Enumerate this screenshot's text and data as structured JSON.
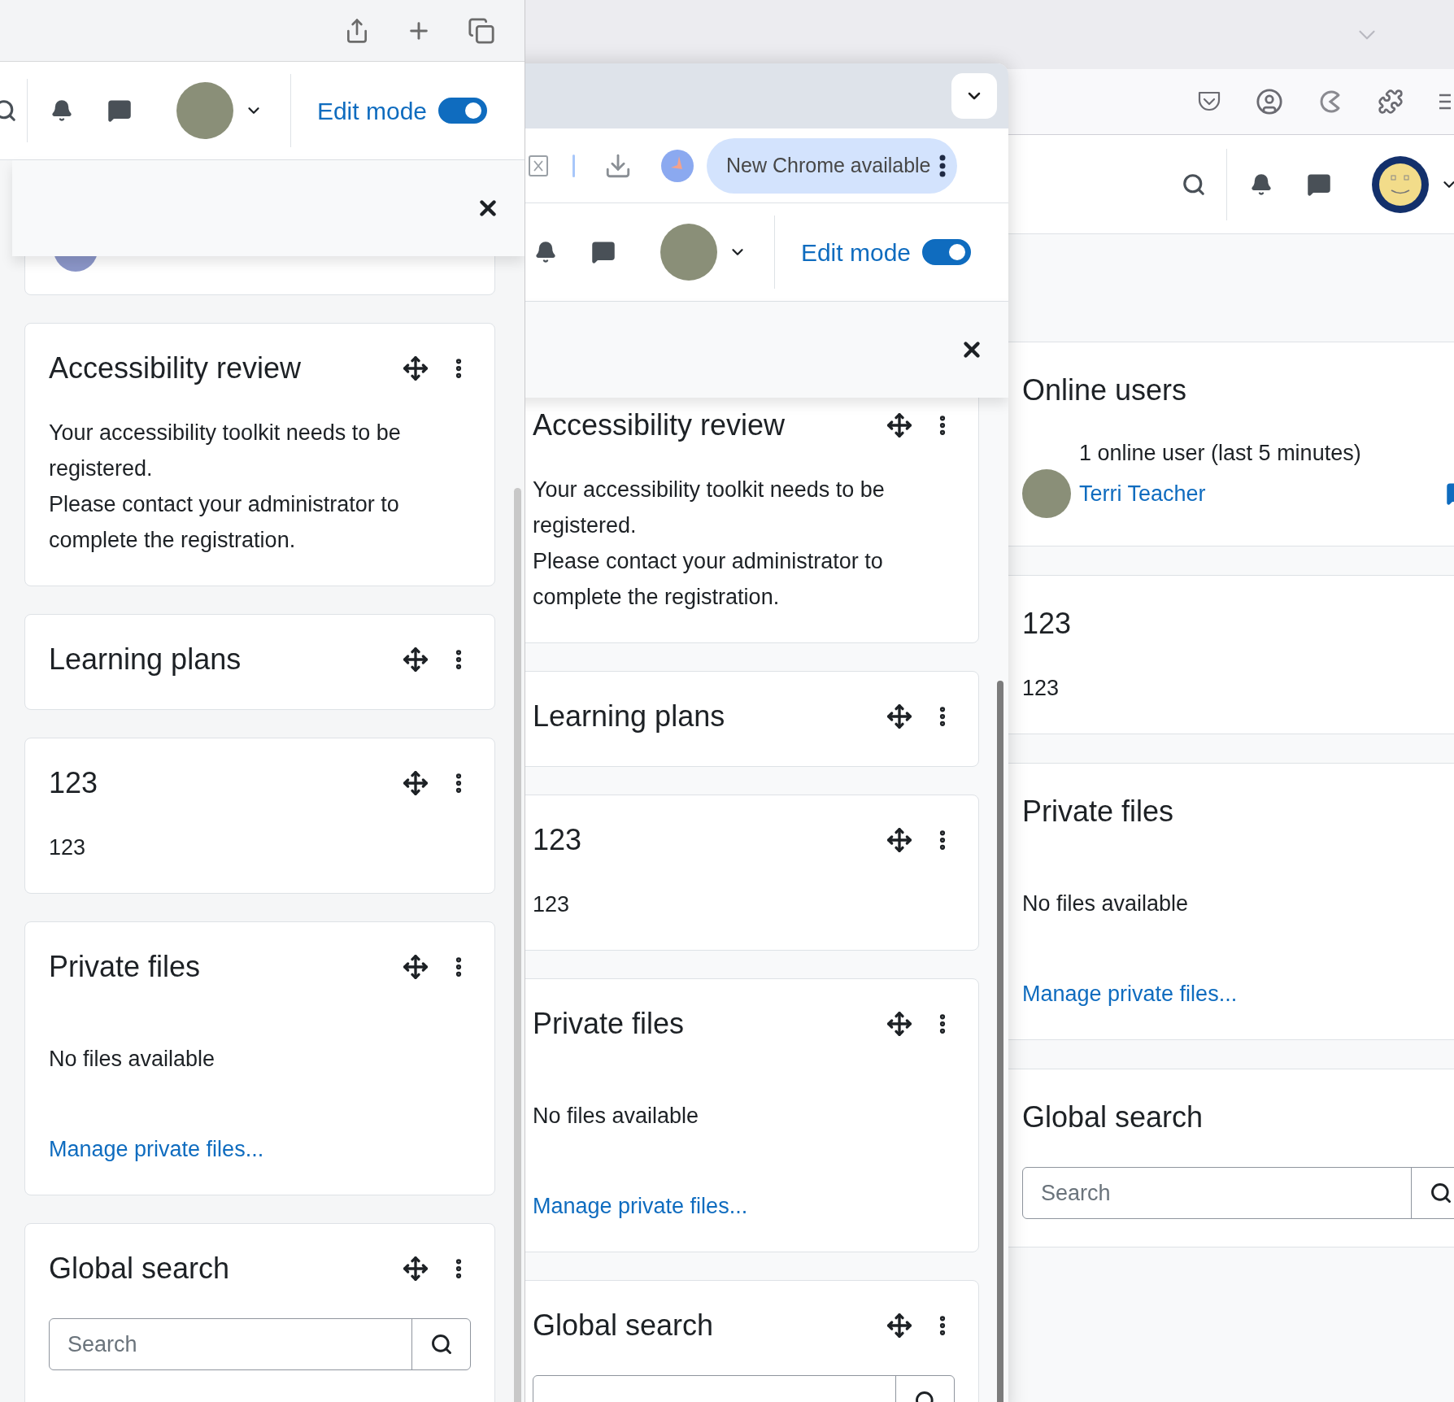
{
  "left_window": {
    "header": {
      "edit_mode": {
        "label": "Edit mode",
        "on": true
      }
    },
    "blocks": [
      {
        "kind": "text",
        "title": "Accessibility review",
        "paragraphs": [
          "Your accessibility toolkit needs to be registered.",
          "Please contact your administrator to complete the registration."
        ]
      },
      {
        "kind": "text",
        "title": "Learning plans"
      },
      {
        "kind": "text",
        "title": "123",
        "paragraphs": [
          "123"
        ]
      },
      {
        "kind": "files",
        "title": "Private files",
        "message": "No files available",
        "link": "Manage private files..."
      },
      {
        "kind": "search",
        "title": "Global search",
        "placeholder": "Search"
      }
    ]
  },
  "middle_window": {
    "toolbar": {
      "update_button": "New Chrome available"
    },
    "header": {
      "edit_mode": {
        "label": "Edit mode",
        "on": true
      }
    },
    "blocks": [
      {
        "kind": "text",
        "title": "Accessibility review",
        "paragraphs": [
          "Your accessibility toolkit needs to be registered.",
          "Please contact your administrator to complete the registration."
        ]
      },
      {
        "kind": "text",
        "title": "Learning plans"
      },
      {
        "kind": "text",
        "title": "123",
        "paragraphs": [
          "123"
        ]
      },
      {
        "kind": "files",
        "title": "Private files",
        "message": "No files available",
        "link": "Manage private files..."
      },
      {
        "kind": "search",
        "title": "Global search"
      }
    ]
  },
  "right_window": {
    "blocks": [
      {
        "kind": "online",
        "title": "Online users",
        "summary": "1 online user (last 5 minutes)",
        "users": [
          {
            "name": "Terri Teacher"
          }
        ]
      },
      {
        "kind": "text",
        "title": "123",
        "paragraphs": [
          "123"
        ]
      },
      {
        "kind": "files",
        "title": "Private files",
        "message": "No files available",
        "link": "Manage private files..."
      },
      {
        "kind": "search",
        "title": "Global search",
        "placeholder": "Search"
      }
    ]
  }
}
